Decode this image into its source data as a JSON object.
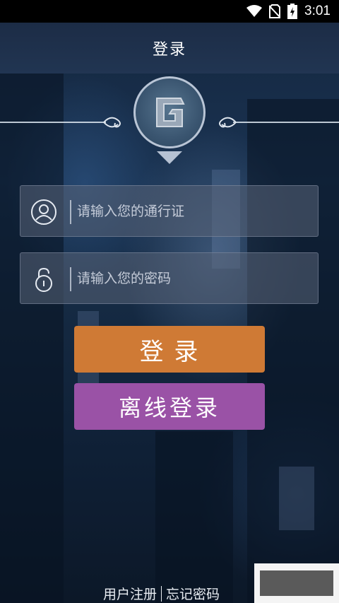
{
  "status_bar": {
    "time": "3:01"
  },
  "header": {
    "title": "登录"
  },
  "login_form": {
    "username_placeholder": "请输入您的通行证",
    "password_placeholder": "请输入您的密码",
    "login_button_label": "登 录",
    "offline_login_button_label": "离线登录"
  },
  "footer": {
    "register_link": "用户注册",
    "forgot_password_link": "忘记密码"
  },
  "colors": {
    "login_button": "#cf7a35",
    "offline_button": "#9a52a6",
    "title_bar": "#213552"
  },
  "icons": [
    "wifi-icon",
    "no-sim-icon",
    "battery-charging-icon",
    "logo-icon",
    "user-icon",
    "lock-icon"
  ]
}
